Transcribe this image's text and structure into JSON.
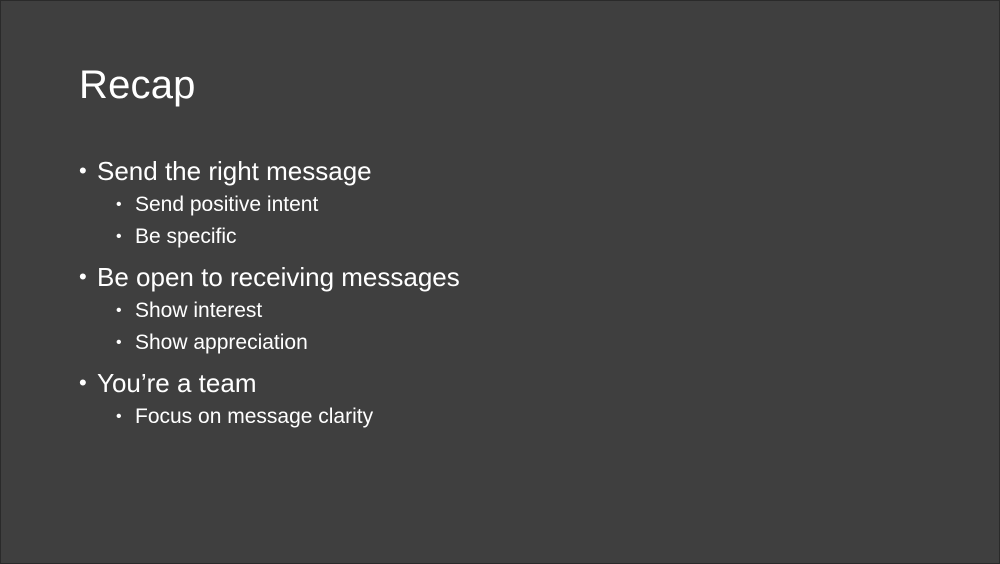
{
  "slide": {
    "title": "Recap",
    "bullets": [
      {
        "text": "Send the right message",
        "sub": [
          "Send positive intent",
          "Be specific"
        ]
      },
      {
        "text": "Be open to receiving messages",
        "sub": [
          "Show interest",
          "Show appreciation"
        ]
      },
      {
        "text": "You’re a team",
        "sub": [
          "Focus on message clarity"
        ]
      }
    ],
    "bullet_glyph": "•"
  }
}
